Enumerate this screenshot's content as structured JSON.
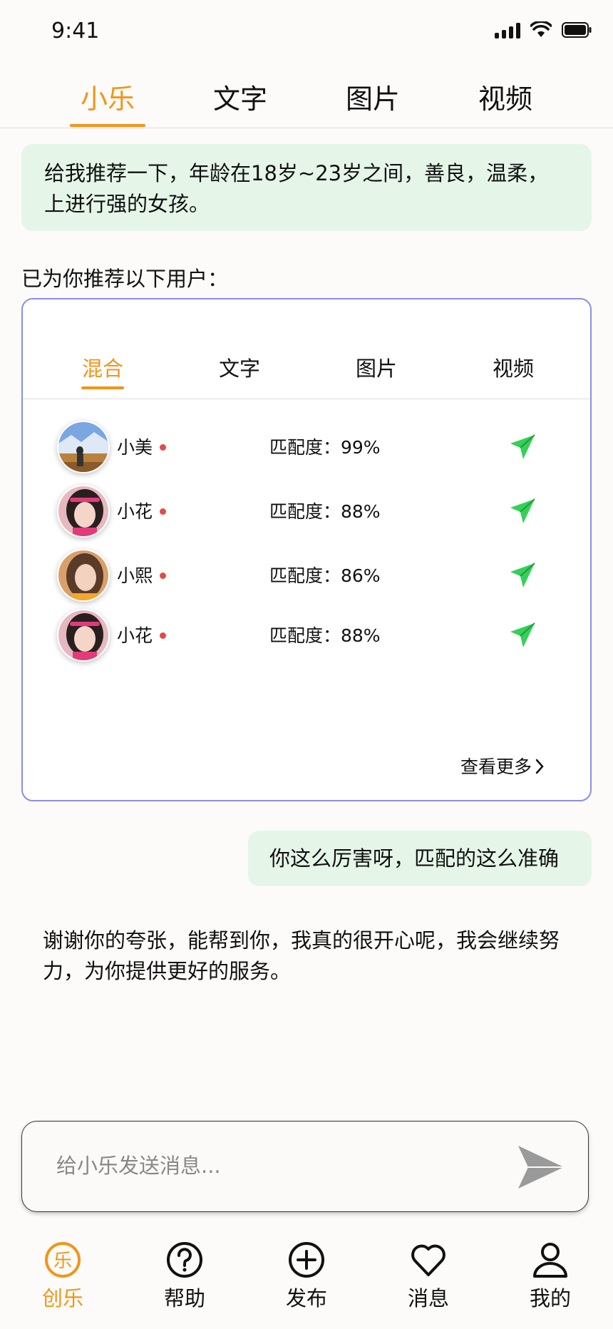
{
  "status_bar": {
    "time": "9:41"
  },
  "top_tabs": [
    {
      "label": "小乐",
      "active": true
    },
    {
      "label": "文字",
      "active": false
    },
    {
      "label": "图片",
      "active": false
    },
    {
      "label": "视频",
      "active": false
    }
  ],
  "chat": {
    "user_prompt": "给我推荐一下，年龄在18岁~23岁之间，善良，温柔，上进行强的女孩。",
    "intro": "已为你推荐以下用户：",
    "user_reply": "你这么厉害呀，匹配的这么准确",
    "assistant_reply": "谢谢你的夸张，能帮到你，我真的很开心呢，我会继续努力，为你提供更好的服务。"
  },
  "recommend_card": {
    "tabs": [
      {
        "label": "混合",
        "active": true
      },
      {
        "label": "文字",
        "active": false
      },
      {
        "label": "图片",
        "active": false
      },
      {
        "label": "视频",
        "active": false
      }
    ],
    "users": [
      {
        "name": "小美",
        "match": "匹配度：99%"
      },
      {
        "name": "小花",
        "match": "匹配度：88%"
      },
      {
        "name": "小熙",
        "match": "匹配度：86%"
      },
      {
        "name": "小花",
        "match": "匹配度：88%"
      }
    ],
    "see_more": "查看更多"
  },
  "input": {
    "placeholder": "给小乐发送消息..."
  },
  "bottom_nav": [
    {
      "label": "创乐",
      "icon": "le-circle-icon",
      "active": true
    },
    {
      "label": "帮助",
      "icon": "help-icon",
      "active": false
    },
    {
      "label": "发布",
      "icon": "plus-circle-icon",
      "active": false
    },
    {
      "label": "消息",
      "icon": "heart-icon",
      "active": false
    },
    {
      "label": "我的",
      "icon": "user-icon",
      "active": false
    }
  ],
  "colors": {
    "accent": "#f39418",
    "bubble": "#e5f6e9",
    "card_border": "#8b8ee8",
    "send_green": "#34d058",
    "online": "#e84848"
  }
}
